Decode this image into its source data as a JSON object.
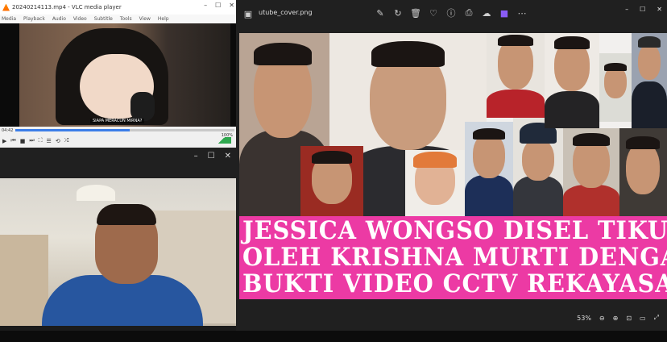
{
  "vlc": {
    "title": "20240214113.mp4 - VLC media player",
    "menu": [
      "Media",
      "Playback",
      "Audio",
      "Video",
      "Subtitle",
      "Tools",
      "View",
      "Help"
    ],
    "caption": "SIAPA MERACUN MIRNA?",
    "time_elapsed": "04:42",
    "volume": "100%",
    "progress": 0.52
  },
  "photos": {
    "filename": "utube_cover.png",
    "zoom": "53%",
    "banner_lines": [
      "JESSICA WONGSO DISEL TIKUS",
      "OLEH KRISHNA MURTI DENGAN",
      "BUKTI VIDEO CCTV REKAYASA!"
    ]
  }
}
